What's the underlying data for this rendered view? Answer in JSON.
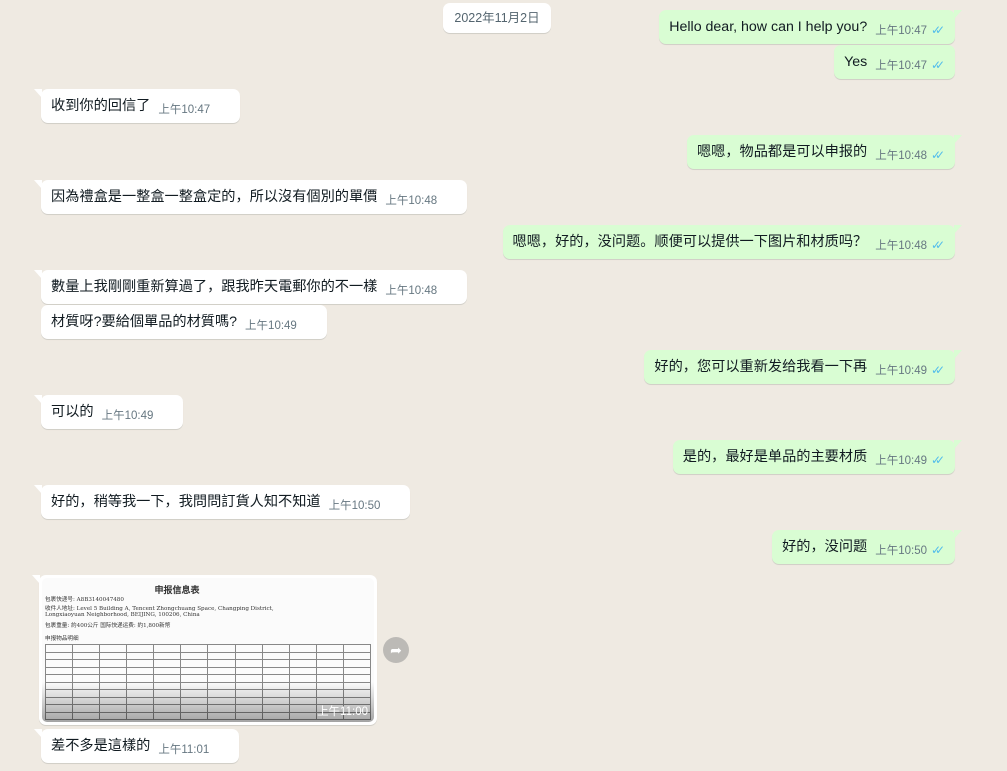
{
  "date_chip": "2022年11月2日",
  "messages": [
    {
      "dir": "out",
      "text": "Hello dear, how can I help you?",
      "time": "上午10:47",
      "ticks": "✓✓"
    },
    {
      "dir": "out",
      "text": "Yes",
      "time": "上午10:47",
      "ticks": "✓✓"
    },
    {
      "dir": "in",
      "text": "收到你的回信了",
      "time": "上午10:47"
    },
    {
      "dir": "out",
      "text": "嗯嗯，物品都是可以申报的",
      "time": "上午10:48",
      "ticks": "✓✓"
    },
    {
      "dir": "in",
      "text": "因為禮盒是一整盒一整盒定的，所以沒有個別的單價",
      "time": "上午10:48"
    },
    {
      "dir": "out",
      "text": "嗯嗯，好的，没问题。顺便可以提供一下图片和材质吗？",
      "time": "上午10:48",
      "ticks": "✓✓"
    },
    {
      "dir": "in",
      "text": "數量上我剛剛重新算過了，跟我昨天電郵你的不一樣",
      "time": "上午10:48"
    },
    {
      "dir": "in",
      "text": "材質呀?要給個單品的材質嗎?",
      "time": "上午10:49"
    },
    {
      "dir": "out",
      "text": "好的，您可以重新发给我看一下再",
      "time": "上午10:49",
      "ticks": "✓✓"
    },
    {
      "dir": "in",
      "text": "可以的",
      "time": "上午10:49"
    },
    {
      "dir": "out",
      "text": "是的，最好是单品的主要材质",
      "time": "上午10:49",
      "ticks": "✓✓"
    },
    {
      "dir": "in",
      "text": "好的，稍等我一下，我問問訂貨人知不知道",
      "time": "上午10:50"
    },
    {
      "dir": "out",
      "text": "好的，没问题",
      "time": "上午10:50",
      "ticks": "✓✓"
    },
    {
      "dir": "in",
      "text": "差不多是這樣的",
      "time": "上午11:01"
    }
  ],
  "image_message": {
    "time": "上午11:00",
    "forward_icon": "forward-arrow-icon",
    "document": {
      "title": "申报信息表",
      "line1": "包裹快递号: A8B3140047480",
      "line2": "收件人地址: Level 5 Building A, Tencent Zhongchuang Space, Changping District,",
      "line3": "Longxiaoyuan Neighborhood, BEIJING, 100206, China",
      "line4": "包裹重量: 約400公斤          国际快递运费: 約1,800新幣",
      "line5": "申报物品明细"
    }
  },
  "colors": {
    "background": "#efeae2",
    "outgoing_bubble": "#d9fdd3",
    "incoming_bubble": "#ffffff",
    "read_ticks": "#53bdeb",
    "time_text": "#667781"
  }
}
